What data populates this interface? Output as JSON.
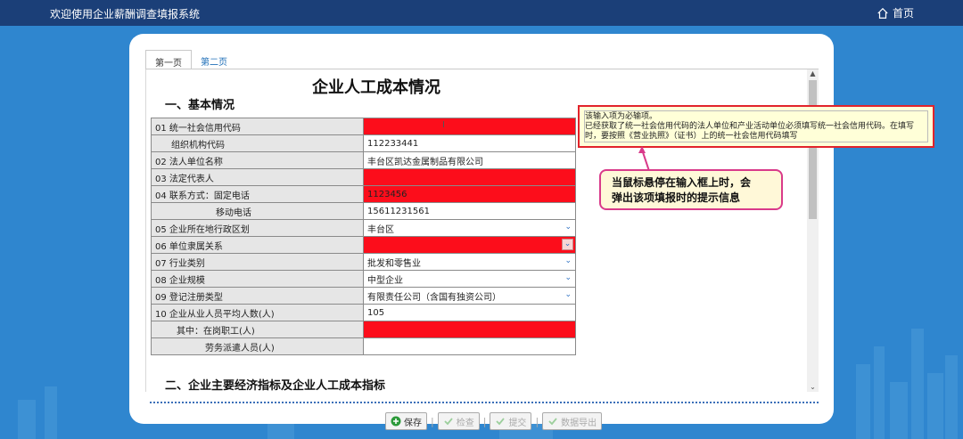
{
  "app_title": "欢迎使用企业薪酬调查填报系统",
  "home_label": "首页",
  "tabs": [
    {
      "label": "第一页",
      "active": true
    },
    {
      "label": "第二页",
      "active": false
    }
  ],
  "page_title": "企业人工成本情况",
  "section1": "一、基本情况",
  "section2": "二、企业主要经济指标及企业人工成本指标",
  "rows": [
    {
      "label": "01 统一社会信用代码",
      "value": "",
      "required": true
    },
    {
      "label": "组织机构代码",
      "value": "112233441",
      "required": false
    },
    {
      "label": "02 法人单位名称",
      "value": "丰台区凯达金属制品有限公司",
      "required": false
    },
    {
      "label": "03 法定代表人",
      "value": "",
      "required": true
    },
    {
      "label": "04 联系方式：固定电话",
      "value": "1123456",
      "required": true
    },
    {
      "label": "移动电话",
      "value": "15611231561",
      "required": false
    },
    {
      "label": "05 企业所在地行政区划",
      "value": "丰台区",
      "required": false
    },
    {
      "label": "06 单位隶属关系",
      "value": "",
      "required": true
    },
    {
      "label": "07 行业类别",
      "value": "批发和零售业",
      "required": false
    },
    {
      "label": "08 企业规模",
      "value": "中型企业",
      "required": false
    },
    {
      "label": "09 登记注册类型",
      "value": "有限责任公司（含国有独资公司）",
      "required": false
    },
    {
      "label": "10 企业从业人员平均人数(人)",
      "value": "105",
      "required": false
    },
    {
      "label": "其中：在岗职工(人)",
      "value": "",
      "required": true
    },
    {
      "label": "劳务派遣人员(人)",
      "value": "",
      "required": false
    }
  ],
  "tooltip": {
    "line1": "该输入项为必输项。",
    "line2": "已经获取了统一社会信用代码的法人单位和产业活动单位必须填写统一社会信用代码。在填写时，要按照《营业执照》（证书）上的统一社会信用代码填写"
  },
  "callout": {
    "line1": "当鼠标悬停在输入框上时，会",
    "line2": "弹出该项填报时的提示信息"
  },
  "buttons": [
    {
      "label": "保存",
      "enabled": true
    },
    {
      "label": "检查",
      "enabled": false
    },
    {
      "label": "提交",
      "enabled": false
    },
    {
      "label": "数据导出",
      "enabled": false
    }
  ],
  "colors": {
    "topbar": "#1b3f78",
    "background": "#2f86cf",
    "required_field": "#fc0d1b",
    "tooltip_border": "#e2232b",
    "callout_border": "#d93a8a"
  }
}
